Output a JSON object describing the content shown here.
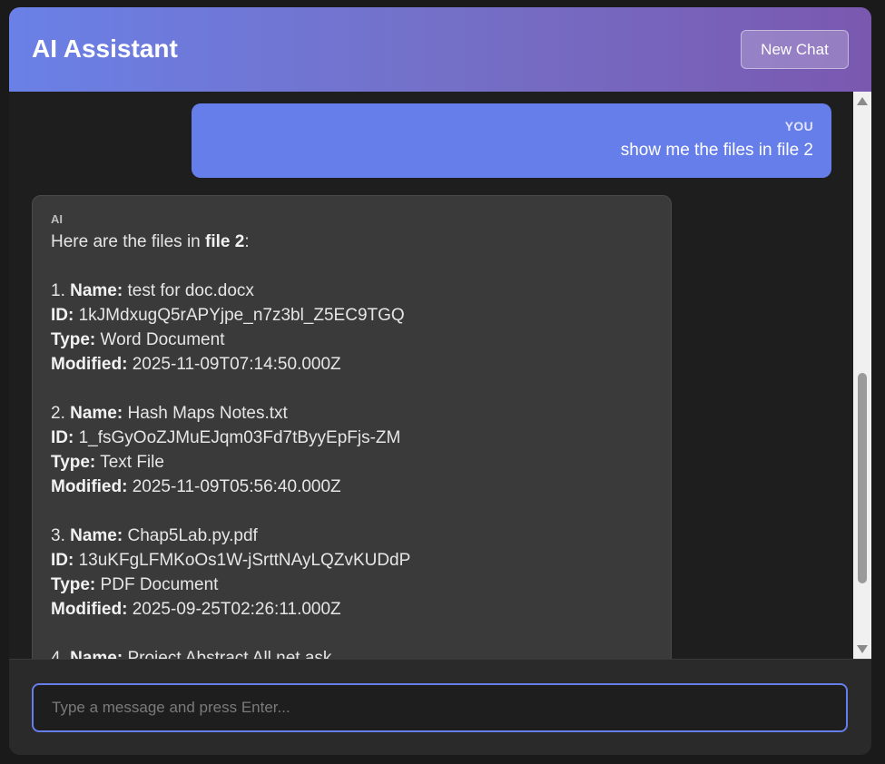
{
  "header": {
    "title": "AI Assistant",
    "new_chat_label": "New Chat"
  },
  "messages": {
    "user": {
      "role": "YOU",
      "text": "show me the files in file 2"
    },
    "ai": {
      "role": "AI",
      "intro_prefix": "Here are the files in ",
      "intro_bold": "file 2",
      "intro_suffix": ":",
      "label_name": "Name:",
      "label_id": "ID:",
      "label_type": "Type:",
      "label_modified": "Modified:",
      "files": [
        {
          "num": "1. ",
          "name": "test for doc.docx",
          "id": "1kJMdxugQ5rAPYjpe_n7z3bl_Z5EC9TGQ",
          "type": "Word Document",
          "modified": "2025-11-09T07:14:50.000Z"
        },
        {
          "num": "2. ",
          "name": "Hash Maps Notes.txt",
          "id": "1_fsGyOoZJMuEJqm03Fd7tByyEpFjs-ZM",
          "type": "Text File",
          "modified": "2025-11-09T05:56:40.000Z"
        },
        {
          "num": "3. ",
          "name": "Chap5Lab.py.pdf",
          "id": "13uKFgLFMKoOs1W-jSrttNAyLQZvKUDdP",
          "type": "PDF Document",
          "modified": "2025-09-25T02:26:11.000Z"
        },
        {
          "num": "4. ",
          "name": "Project Abstract All.net.ask"
        }
      ]
    }
  },
  "input": {
    "placeholder": "Type a message and press Enter..."
  },
  "colors": {
    "accent": "#667eea",
    "header_end": "#764ba2",
    "ai_bubble": "#3a3a3a",
    "background": "#1e1e1e"
  }
}
